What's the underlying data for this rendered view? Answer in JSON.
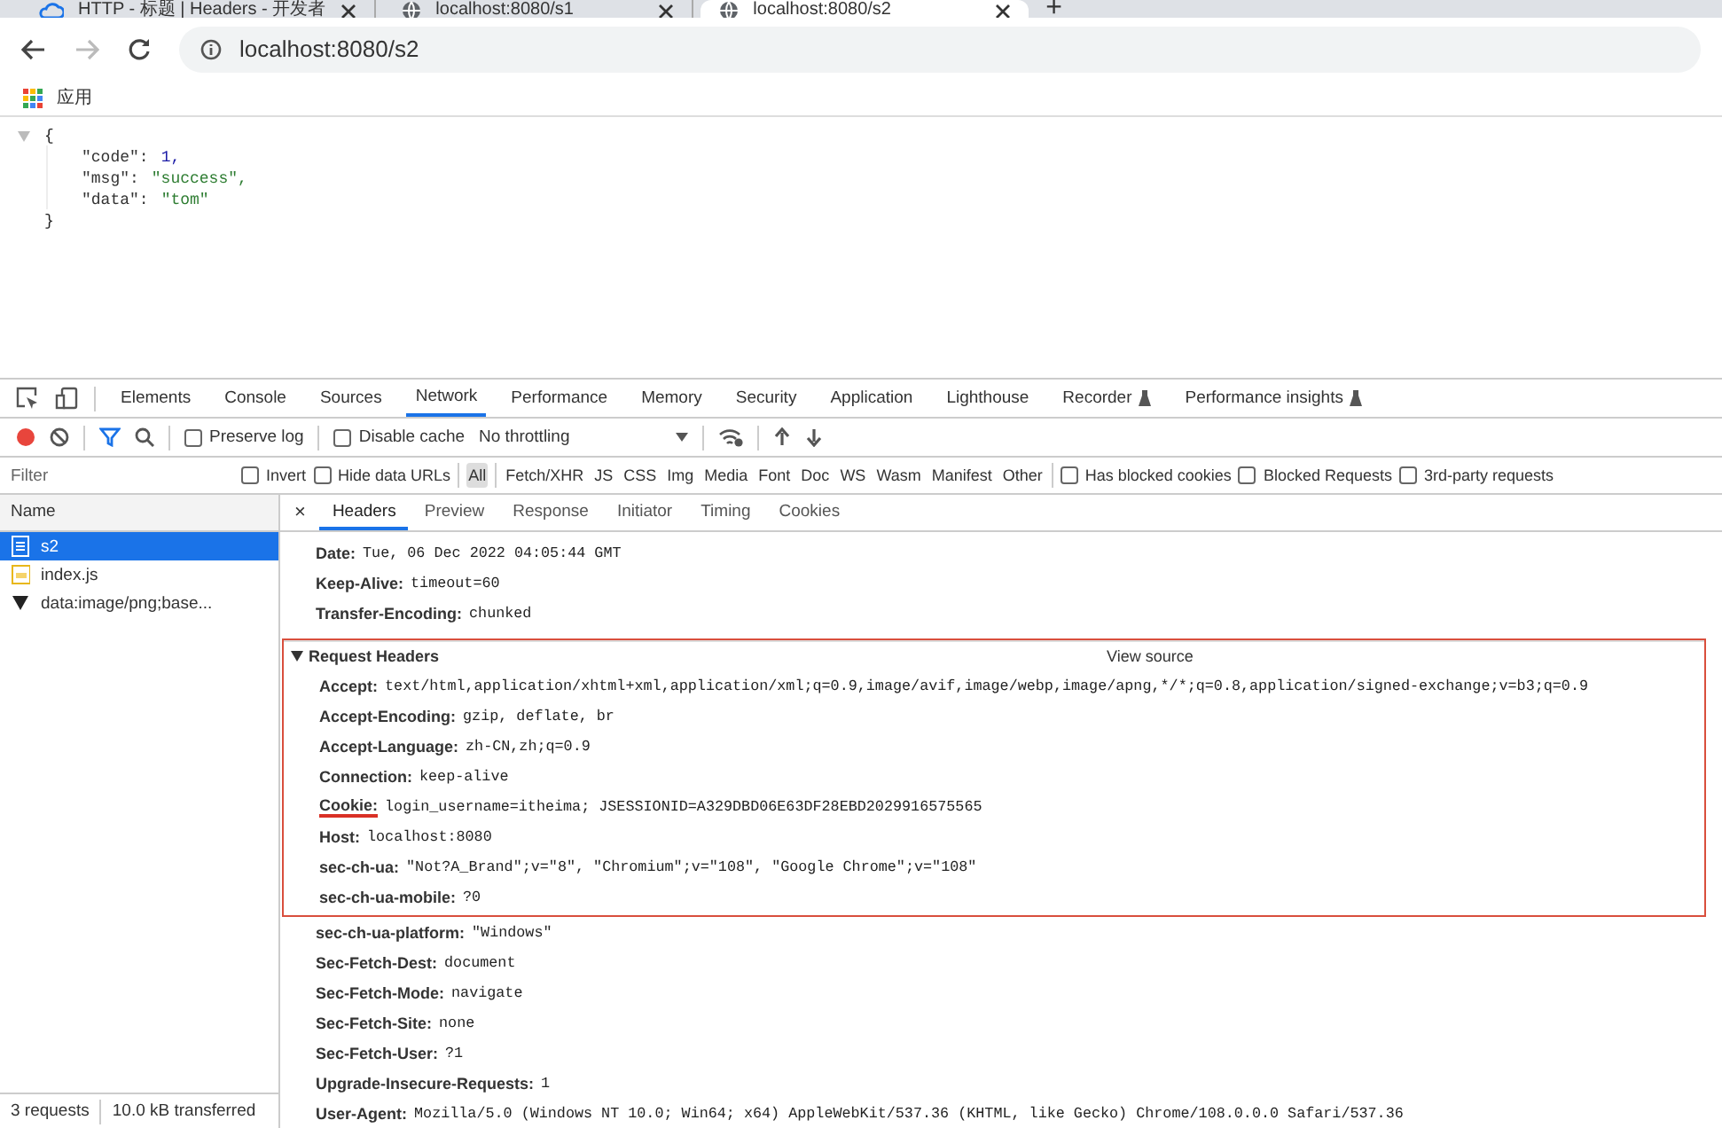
{
  "browser": {
    "tabs": [
      {
        "title": "HTTP - 标题 | Headers - 开发者",
        "selected": false
      },
      {
        "title": "localhost:8080/s1",
        "selected": false
      },
      {
        "title": "localhost:8080/s2",
        "selected": true
      }
    ],
    "new_tab": "+",
    "address": "localhost:8080/s2",
    "bookmarks": [
      {
        "label": "应用"
      }
    ]
  },
  "page": {
    "open": "{",
    "close": "}",
    "lines": [
      {
        "key": "\"code\":",
        "value": "1,",
        "kind": "number"
      },
      {
        "key": "\"msg\":",
        "value": "\"success\",",
        "kind": "string"
      },
      {
        "key": "\"data\":",
        "value": "\"tom\"",
        "kind": "string"
      }
    ]
  },
  "devtools": {
    "panel_tabs": [
      {
        "label": "Elements",
        "selected": false,
        "experimental": false
      },
      {
        "label": "Console",
        "selected": false,
        "experimental": false
      },
      {
        "label": "Sources",
        "selected": false,
        "experimental": false
      },
      {
        "label": "Network",
        "selected": true,
        "experimental": false
      },
      {
        "label": "Performance",
        "selected": false,
        "experimental": false
      },
      {
        "label": "Memory",
        "selected": false,
        "experimental": false
      },
      {
        "label": "Security",
        "selected": false,
        "experimental": false
      },
      {
        "label": "Application",
        "selected": false,
        "experimental": false
      },
      {
        "label": "Lighthouse",
        "selected": false,
        "experimental": false
      },
      {
        "label": "Recorder",
        "selected": false,
        "experimental": true
      },
      {
        "label": "Performance insights",
        "selected": false,
        "experimental": true
      }
    ],
    "toolbar": {
      "recording": true,
      "options": [
        {
          "label": "Preserve log",
          "checked": false
        },
        {
          "label": "Disable cache",
          "checked": false
        }
      ],
      "throttling": "No throttling"
    },
    "filter": {
      "placeholder": "Filter",
      "options": [
        {
          "label": "Invert",
          "checked": false
        },
        {
          "label": "Hide data URLs",
          "checked": false
        }
      ],
      "types": [
        {
          "label": "All",
          "selected": true
        },
        {
          "label": "Fetch/XHR",
          "selected": false
        },
        {
          "label": "JS",
          "selected": false
        },
        {
          "label": "CSS",
          "selected": false
        },
        {
          "label": "Img",
          "selected": false
        },
        {
          "label": "Media",
          "selected": false
        },
        {
          "label": "Font",
          "selected": false
        },
        {
          "label": "Doc",
          "selected": false
        },
        {
          "label": "WS",
          "selected": false
        },
        {
          "label": "Wasm",
          "selected": false
        },
        {
          "label": "Manifest",
          "selected": false
        },
        {
          "label": "Other",
          "selected": false
        }
      ],
      "more_options": [
        {
          "label": "Has blocked cookies",
          "checked": false
        },
        {
          "label": "Blocked Requests",
          "checked": false
        },
        {
          "label": "3rd-party requests",
          "checked": false
        }
      ]
    },
    "requests": {
      "column": "Name",
      "items": [
        {
          "name": "s2",
          "kind": "document",
          "selected": true
        },
        {
          "name": "index.js",
          "kind": "script",
          "selected": false
        },
        {
          "name": "data:image/png;base...",
          "kind": "image",
          "selected": false
        }
      ],
      "status": [
        "3 requests",
        "10.0 kB transferred"
      ]
    },
    "detail": {
      "close": "×",
      "tabs": [
        {
          "label": "Headers",
          "selected": true
        },
        {
          "label": "Preview",
          "selected": false
        },
        {
          "label": "Response",
          "selected": false
        },
        {
          "label": "Initiator",
          "selected": false
        },
        {
          "label": "Timing",
          "selected": false
        },
        {
          "label": "Cookies",
          "selected": false
        }
      ],
      "response_headers": [
        {
          "name": "Date:",
          "value": "Tue, 06 Dec 2022 04:05:44 GMT"
        },
        {
          "name": "Keep-Alive:",
          "value": "timeout=60"
        },
        {
          "name": "Transfer-Encoding:",
          "value": "chunked"
        }
      ],
      "request_section": {
        "title": "Request Headers",
        "view_source": "View source",
        "expanded": true
      },
      "request_headers": [
        {
          "name": "Accept:",
          "value": "text/html,application/xhtml+xml,application/xml;q=0.9,image/avif,image/webp,image/apng,*/*;q=0.8,application/signed-exchange;v=b3;q=0.9",
          "boxed": true,
          "underlined": false
        },
        {
          "name": "Accept-Encoding:",
          "value": "gzip, deflate, br",
          "boxed": true,
          "underlined": false
        },
        {
          "name": "Accept-Language:",
          "value": "zh-CN,zh;q=0.9",
          "boxed": true,
          "underlined": false
        },
        {
          "name": "Connection:",
          "value": "keep-alive",
          "boxed": true,
          "underlined": false
        },
        {
          "name": "Cookie:",
          "value": "login_username=itheima; JSESSIONID=A329DBD06E63DF28EBD2029916575565",
          "boxed": true,
          "underlined": true
        },
        {
          "name": "Host:",
          "value": "localhost:8080",
          "boxed": true,
          "underlined": false
        },
        {
          "name": "sec-ch-ua:",
          "value": "\"Not?A_Brand\";v=\"8\", \"Chromium\";v=\"108\", \"Google Chrome\";v=\"108\"",
          "boxed": true,
          "underlined": false
        },
        {
          "name": "sec-ch-ua-mobile:",
          "value": "?0",
          "boxed": true,
          "underlined": false
        },
        {
          "name": "sec-ch-ua-platform:",
          "value": "\"Windows\"",
          "boxed": false,
          "underlined": false
        },
        {
          "name": "Sec-Fetch-Dest:",
          "value": "document",
          "boxed": false,
          "underlined": false
        },
        {
          "name": "Sec-Fetch-Mode:",
          "value": "navigate",
          "boxed": false,
          "underlined": false
        },
        {
          "name": "Sec-Fetch-Site:",
          "value": "none",
          "boxed": false,
          "underlined": false
        },
        {
          "name": "Sec-Fetch-User:",
          "value": "?1",
          "boxed": false,
          "underlined": false
        },
        {
          "name": "Upgrade-Insecure-Requests:",
          "value": "1",
          "boxed": false,
          "underlined": false
        },
        {
          "name": "User-Agent:",
          "value": "Mozilla/5.0 (Windows NT 10.0; Win64; x64) AppleWebKit/537.36 (KHTML, like Gecko) Chrome/108.0.0.0 Safari/537.36",
          "boxed": false,
          "underlined": false
        }
      ]
    }
  }
}
